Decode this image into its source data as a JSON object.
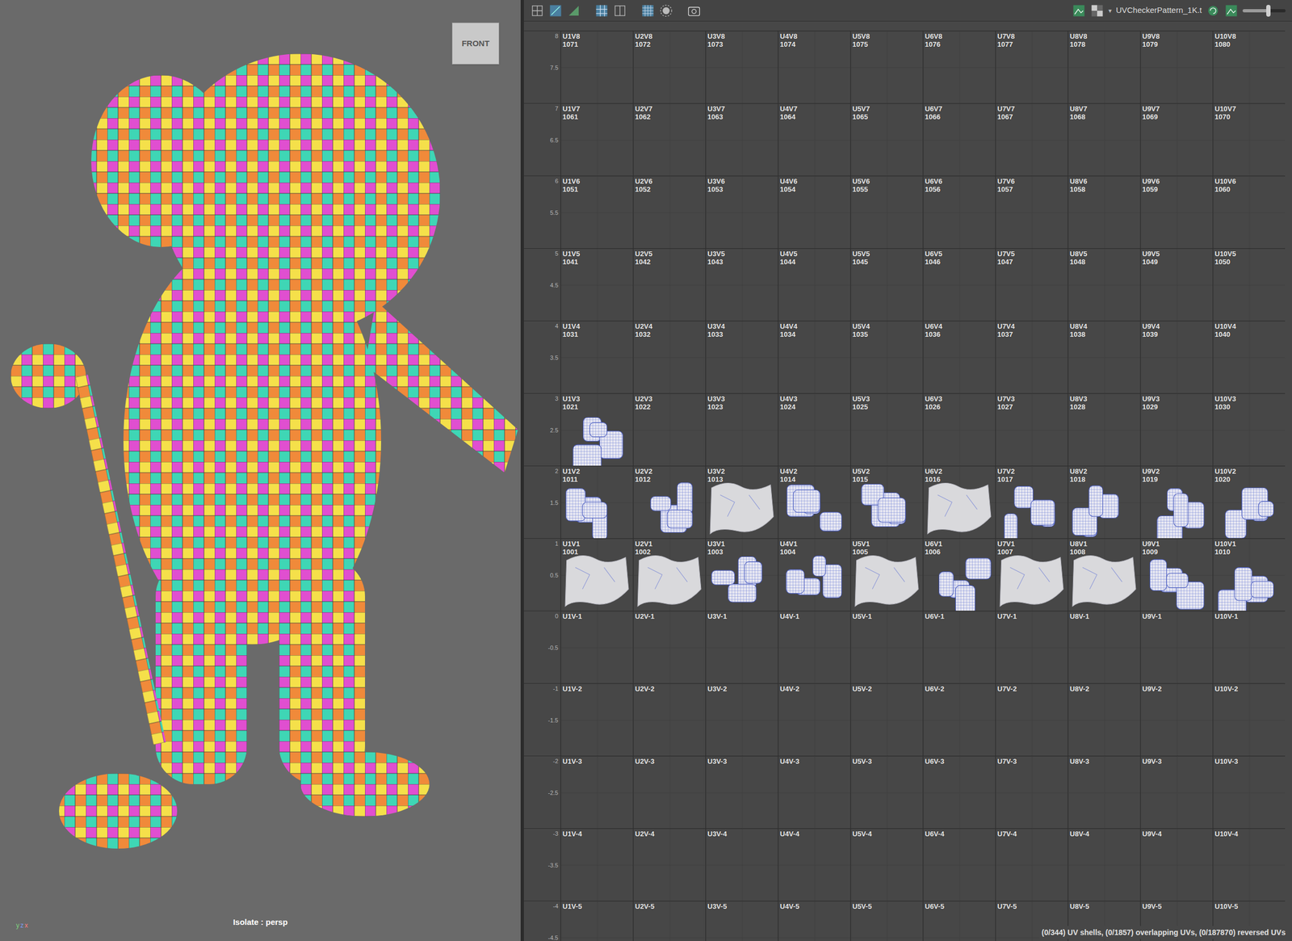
{
  "viewport": {
    "view_cube": "FRONT",
    "caption": "Isolate : persp",
    "axes": [
      "y",
      "z",
      "x"
    ]
  },
  "uv_editor": {
    "texture": "UVCheckerPattern_1K.t",
    "slider": {
      "level": 0.6
    },
    "status": "(0/344) UV shells, (0/1857) overlapping UVs, (0/187870) reversed UVs",
    "rows": [
      {
        "ticks": [
          "8",
          "7.5"
        ],
        "tiles": [
          {
            "label": "U1V8",
            "udim": "1071",
            "shells": "none"
          },
          {
            "label": "U2V8",
            "udim": "1072",
            "shells": "none"
          },
          {
            "label": "U3V8",
            "udim": "1073",
            "shells": "none"
          },
          {
            "label": "U4V8",
            "udim": "1074",
            "shells": "none"
          },
          {
            "label": "U5V8",
            "udim": "1075",
            "shells": "none"
          },
          {
            "label": "U6V8",
            "udim": "1076",
            "shells": "none"
          },
          {
            "label": "U7V8",
            "udim": "1077",
            "shells": "none"
          },
          {
            "label": "U8V8",
            "udim": "1078",
            "shells": "none"
          },
          {
            "label": "U9V8",
            "udim": "1079",
            "shells": "none"
          },
          {
            "label": "U10V8",
            "udim": "1080",
            "shells": "none"
          }
        ]
      },
      {
        "ticks": [
          "7",
          "6.5"
        ],
        "tiles": [
          {
            "label": "U1V7",
            "udim": "1061",
            "shells": "none"
          },
          {
            "label": "U2V7",
            "udim": "1062",
            "shells": "none"
          },
          {
            "label": "U3V7",
            "udim": "1063",
            "shells": "none"
          },
          {
            "label": "U4V7",
            "udim": "1064",
            "shells": "none"
          },
          {
            "label": "U5V7",
            "udim": "1065",
            "shells": "none"
          },
          {
            "label": "U6V7",
            "udim": "1066",
            "shells": "none"
          },
          {
            "label": "U7V7",
            "udim": "1067",
            "shells": "none"
          },
          {
            "label": "U8V7",
            "udim": "1068",
            "shells": "none"
          },
          {
            "label": "U9V7",
            "udim": "1069",
            "shells": "none"
          },
          {
            "label": "U10V7",
            "udim": "1070",
            "shells": "none"
          }
        ]
      },
      {
        "ticks": [
          "6",
          "5.5"
        ],
        "tiles": [
          {
            "label": "U1V6",
            "udim": "1051",
            "shells": "none"
          },
          {
            "label": "U2V6",
            "udim": "1052",
            "shells": "none"
          },
          {
            "label": "U3V6",
            "udim": "1053",
            "shells": "none"
          },
          {
            "label": "U4V6",
            "udim": "1054",
            "shells": "none"
          },
          {
            "label": "U5V6",
            "udim": "1055",
            "shells": "none"
          },
          {
            "label": "U6V6",
            "udim": "1056",
            "shells": "none"
          },
          {
            "label": "U7V6",
            "udim": "1057",
            "shells": "none"
          },
          {
            "label": "U8V6",
            "udim": "1058",
            "shells": "none"
          },
          {
            "label": "U9V6",
            "udim": "1059",
            "shells": "none"
          },
          {
            "label": "U10V6",
            "udim": "1060",
            "shells": "none"
          }
        ]
      },
      {
        "ticks": [
          "5",
          "4.5"
        ],
        "tiles": [
          {
            "label": "U1V5",
            "udim": "1041",
            "shells": "none"
          },
          {
            "label": "U2V5",
            "udim": "1042",
            "shells": "none"
          },
          {
            "label": "U3V5",
            "udim": "1043",
            "shells": "none"
          },
          {
            "label": "U4V5",
            "udim": "1044",
            "shells": "none"
          },
          {
            "label": "U5V5",
            "udim": "1045",
            "shells": "none"
          },
          {
            "label": "U6V5",
            "udim": "1046",
            "shells": "none"
          },
          {
            "label": "U7V5",
            "udim": "1047",
            "shells": "none"
          },
          {
            "label": "U8V5",
            "udim": "1048",
            "shells": "none"
          },
          {
            "label": "U9V5",
            "udim": "1049",
            "shells": "none"
          },
          {
            "label": "U10V5",
            "udim": "1050",
            "shells": "none"
          }
        ]
      },
      {
        "ticks": [
          "4",
          "3.5"
        ],
        "tiles": [
          {
            "label": "U1V4",
            "udim": "1031",
            "shells": "none"
          },
          {
            "label": "U2V4",
            "udim": "1032",
            "shells": "none"
          },
          {
            "label": "U3V4",
            "udim": "1033",
            "shells": "none"
          },
          {
            "label": "U4V4",
            "udim": "1034",
            "shells": "none"
          },
          {
            "label": "U5V4",
            "udim": "1035",
            "shells": "none"
          },
          {
            "label": "U6V4",
            "udim": "1036",
            "shells": "none"
          },
          {
            "label": "U7V4",
            "udim": "1037",
            "shells": "none"
          },
          {
            "label": "U8V4",
            "udim": "1038",
            "shells": "none"
          },
          {
            "label": "U9V4",
            "udim": "1039",
            "shells": "none"
          },
          {
            "label": "U10V4",
            "udim": "1040",
            "shells": "none"
          }
        ]
      },
      {
        "ticks": [
          "3",
          "2.5"
        ],
        "tiles": [
          {
            "label": "U1V3",
            "udim": "1021",
            "shells": "wire"
          },
          {
            "label": "U2V3",
            "udim": "1022",
            "shells": "none"
          },
          {
            "label": "U3V3",
            "udim": "1023",
            "shells": "none"
          },
          {
            "label": "U4V3",
            "udim": "1024",
            "shells": "none"
          },
          {
            "label": "U5V3",
            "udim": "1025",
            "shells": "none"
          },
          {
            "label": "U6V3",
            "udim": "1026",
            "shells": "none"
          },
          {
            "label": "U7V3",
            "udim": "1027",
            "shells": "none"
          },
          {
            "label": "U8V3",
            "udim": "1028",
            "shells": "none"
          },
          {
            "label": "U9V3",
            "udim": "1029",
            "shells": "none"
          },
          {
            "label": "U10V3",
            "udim": "1030",
            "shells": "none"
          }
        ]
      },
      {
        "ticks": [
          "2",
          "1.5"
        ],
        "tiles": [
          {
            "label": "U1V2",
            "udim": "1011",
            "shells": "wire"
          },
          {
            "label": "U2V2",
            "udim": "1012",
            "shells": "wire"
          },
          {
            "label": "U3V2",
            "udim": "1013",
            "shells": "solid"
          },
          {
            "label": "U4V2",
            "udim": "1014",
            "shells": "wire"
          },
          {
            "label": "U5V2",
            "udim": "1015",
            "shells": "wire"
          },
          {
            "label": "U6V2",
            "udim": "1016",
            "shells": "solid"
          },
          {
            "label": "U7V2",
            "udim": "1017",
            "shells": "wire"
          },
          {
            "label": "U8V2",
            "udim": "1018",
            "shells": "wire"
          },
          {
            "label": "U9V2",
            "udim": "1019",
            "shells": "wire"
          },
          {
            "label": "U10V2",
            "udim": "1020",
            "shells": "wire"
          }
        ]
      },
      {
        "ticks": [
          "1",
          "0.5"
        ],
        "tiles": [
          {
            "label": "U1V1",
            "udim": "1001",
            "shells": "solid"
          },
          {
            "label": "U2V1",
            "udim": "1002",
            "shells": "solid"
          },
          {
            "label": "U3V1",
            "udim": "1003",
            "shells": "wire"
          },
          {
            "label": "U4V1",
            "udim": "1004",
            "shells": "wire"
          },
          {
            "label": "U5V1",
            "udim": "1005",
            "shells": "solid"
          },
          {
            "label": "U6V1",
            "udim": "1006",
            "shells": "wire"
          },
          {
            "label": "U7V1",
            "udim": "1007",
            "shells": "solid"
          },
          {
            "label": "U8V1",
            "udim": "1008",
            "shells": "solid"
          },
          {
            "label": "U9V1",
            "udim": "1009",
            "shells": "wire"
          },
          {
            "label": "U10V1",
            "udim": "1010",
            "shells": "wire"
          }
        ]
      },
      {
        "ticks": [
          "0",
          "-0.5"
        ],
        "tiles": [
          {
            "label": "U1V-1",
            "udim": "",
            "shells": "none"
          },
          {
            "label": "U2V-1",
            "udim": "",
            "shells": "none"
          },
          {
            "label": "U3V-1",
            "udim": "",
            "shells": "none"
          },
          {
            "label": "U4V-1",
            "udim": "",
            "shells": "none"
          },
          {
            "label": "U5V-1",
            "udim": "",
            "shells": "none"
          },
          {
            "label": "U6V-1",
            "udim": "",
            "shells": "none"
          },
          {
            "label": "U7V-1",
            "udim": "",
            "shells": "none"
          },
          {
            "label": "U8V-1",
            "udim": "",
            "shells": "none"
          },
          {
            "label": "U9V-1",
            "udim": "",
            "shells": "none"
          },
          {
            "label": "U10V-1",
            "udim": "",
            "shells": "none"
          }
        ]
      },
      {
        "ticks": [
          "-1",
          "-1.5"
        ],
        "tiles": [
          {
            "label": "U1V-2",
            "udim": "",
            "shells": "none"
          },
          {
            "label": "U2V-2",
            "udim": "",
            "shells": "none"
          },
          {
            "label": "U3V-2",
            "udim": "",
            "shells": "none"
          },
          {
            "label": "U4V-2",
            "udim": "",
            "shells": "none"
          },
          {
            "label": "U5V-2",
            "udim": "",
            "shells": "none"
          },
          {
            "label": "U6V-2",
            "udim": "",
            "shells": "none"
          },
          {
            "label": "U7V-2",
            "udim": "",
            "shells": "none"
          },
          {
            "label": "U8V-2",
            "udim": "",
            "shells": "none"
          },
          {
            "label": "U9V-2",
            "udim": "",
            "shells": "none"
          },
          {
            "label": "U10V-2",
            "udim": "",
            "shells": "none"
          }
        ]
      },
      {
        "ticks": [
          "-2",
          "-2.5"
        ],
        "tiles": [
          {
            "label": "U1V-3",
            "udim": "",
            "shells": "none"
          },
          {
            "label": "U2V-3",
            "udim": "",
            "shells": "none"
          },
          {
            "label": "U3V-3",
            "udim": "",
            "shells": "none"
          },
          {
            "label": "U4V-3",
            "udim": "",
            "shells": "none"
          },
          {
            "label": "U5V-3",
            "udim": "",
            "shells": "none"
          },
          {
            "label": "U6V-3",
            "udim": "",
            "shells": "none"
          },
          {
            "label": "U7V-3",
            "udim": "",
            "shells": "none"
          },
          {
            "label": "U8V-3",
            "udim": "",
            "shells": "none"
          },
          {
            "label": "U9V-3",
            "udim": "",
            "shells": "none"
          },
          {
            "label": "U10V-3",
            "udim": "",
            "shells": "none"
          }
        ]
      },
      {
        "ticks": [
          "-3",
          "-3.5"
        ],
        "tiles": [
          {
            "label": "U1V-4",
            "udim": "",
            "shells": "none"
          },
          {
            "label": "U2V-4",
            "udim": "",
            "shells": "none"
          },
          {
            "label": "U3V-4",
            "udim": "",
            "shells": "none"
          },
          {
            "label": "U4V-4",
            "udim": "",
            "shells": "none"
          },
          {
            "label": "U5V-4",
            "udim": "",
            "shells": "none"
          },
          {
            "label": "U6V-4",
            "udim": "",
            "shells": "none"
          },
          {
            "label": "U7V-4",
            "udim": "",
            "shells": "none"
          },
          {
            "label": "U8V-4",
            "udim": "",
            "shells": "none"
          },
          {
            "label": "U9V-4",
            "udim": "",
            "shells": "none"
          },
          {
            "label": "U10V-4",
            "udim": "",
            "shells": "none"
          }
        ]
      },
      {
        "ticks": [
          "-4",
          "-4.5"
        ],
        "tiles": [
          {
            "label": "U1V-5",
            "udim": "",
            "shells": "none"
          },
          {
            "label": "U2V-5",
            "udim": "",
            "shells": "none"
          },
          {
            "label": "U3V-5",
            "udim": "",
            "shells": "none"
          },
          {
            "label": "U4V-5",
            "udim": "",
            "shells": "none"
          },
          {
            "label": "U5V-5",
            "udim": "",
            "shells": "none"
          },
          {
            "label": "U6V-5",
            "udim": "",
            "shells": "none"
          },
          {
            "label": "U7V-5",
            "udim": "",
            "shells": "none"
          },
          {
            "label": "U8V-5",
            "udim": "",
            "shells": "none"
          },
          {
            "label": "U9V-5",
            "udim": "",
            "shells": "none"
          },
          {
            "label": "U10V-5",
            "udim": "",
            "shells": "none"
          }
        ]
      }
    ]
  }
}
